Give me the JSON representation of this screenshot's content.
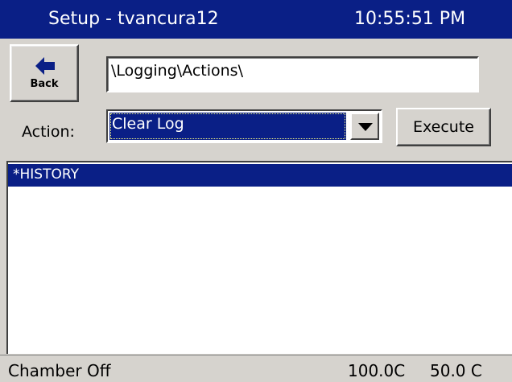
{
  "titlebar": {
    "title": "Setup - tvancura12",
    "clock": "10:55:51 PM"
  },
  "back": {
    "label": "Back",
    "icon": "arrow-left-icon"
  },
  "path": {
    "value": "\\Logging\\Actions\\"
  },
  "action": {
    "label": "Action:",
    "selected": "Clear Log",
    "execute_label": "Execute"
  },
  "list": {
    "items": [
      "*HISTORY"
    ]
  },
  "status": {
    "chamber": "Chamber Off",
    "temp": "100.0C",
    "setpoint": "50.0 C"
  },
  "colors": {
    "accent": "#0a1f86",
    "face": "#d6d3ce"
  }
}
